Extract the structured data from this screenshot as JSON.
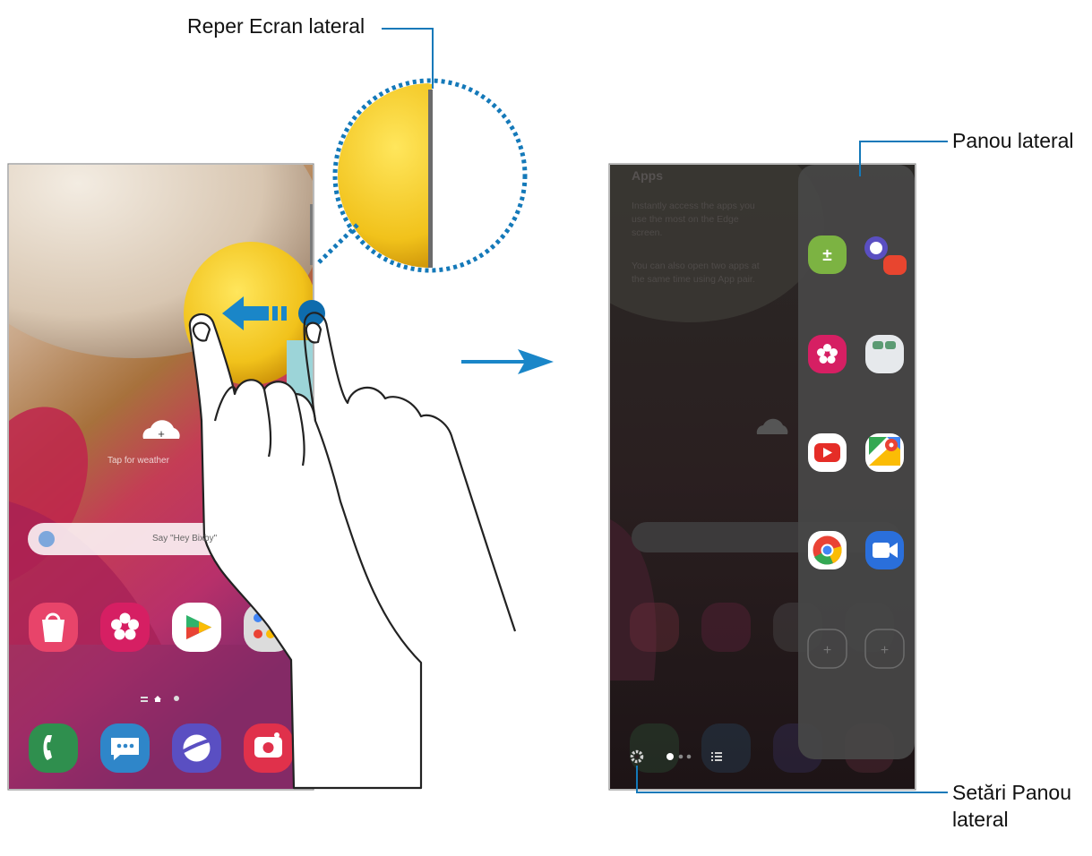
{
  "callouts": {
    "edge_handle": "Reper Ecran lateral",
    "edge_panel": "Panou lateral",
    "panel_settings_line1": "Setări Panou",
    "panel_settings_line2": "lateral"
  },
  "left_phone": {
    "weather_hint": "Tap for weather",
    "search_hint": "Say \"Hey Bixby\"",
    "apps_row": [
      {
        "name": "Galaxy Store",
        "icon": "shopping-bag-icon",
        "color": "#e8446a"
      },
      {
        "name": "Gallery",
        "icon": "flower-icon",
        "color": "#d61f63"
      },
      {
        "name": "Play Store",
        "icon": "play-store-icon",
        "color": "#ffffff"
      },
      {
        "name": "Google",
        "icon": "folder-icon",
        "color": "#d9d9d9"
      }
    ],
    "dock": [
      {
        "name": "Phone",
        "icon": "phone-icon",
        "color": "#2f8f4e"
      },
      {
        "name": "Messages",
        "icon": "chat-icon",
        "color": "#2f86c9"
      },
      {
        "name": "Internet",
        "icon": "planet-icon",
        "color": "#5a4fc2"
      },
      {
        "name": "Camera",
        "icon": "camera-icon",
        "color": "#e0314b"
      }
    ]
  },
  "right_phone": {
    "overlay_title": "Apps",
    "overlay_text_1": "Instantly access the apps you use the most on the Edge screen.",
    "overlay_text_2": "You can also open two apps at the same time using App pair.",
    "panel_apps": [
      {
        "name": "Calculator",
        "icon": "calculator-icon",
        "color": "#7cb342"
      },
      {
        "name": "Internet, Samsung N...",
        "icon": "app-pair-icon",
        "color": "#5a4fc2"
      },
      {
        "name": "Gallery",
        "icon": "flower-icon",
        "color": "#d61f63"
      },
      {
        "name": "Folder",
        "icon": "folder-icon",
        "color": "#e6e9ec"
      },
      {
        "name": "YouTube",
        "icon": "youtube-icon",
        "color": "#ffffff"
      },
      {
        "name": "Maps",
        "icon": "maps-icon",
        "color": "#ffffff"
      },
      {
        "name": "Chrome",
        "icon": "chrome-icon",
        "color": "#ffffff"
      },
      {
        "name": "Duo",
        "icon": "video-icon",
        "color": "#2a6fdb"
      }
    ]
  },
  "colors": {
    "accent": "#1479b9",
    "arrow": "#1a86c8",
    "handle": "#0e6cad",
    "bubble": "#f2c21d"
  }
}
